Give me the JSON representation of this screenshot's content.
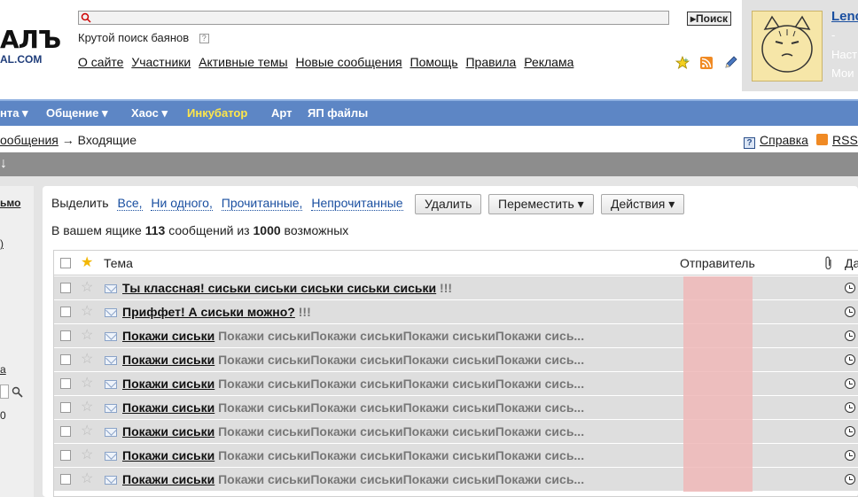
{
  "logo": {
    "main": "АЛЪ",
    "sub": "AL.COM"
  },
  "search": {
    "value": "",
    "button": "Поиск"
  },
  "tagline": {
    "text": "Крутой поиск баянов",
    "help": "?"
  },
  "topnav": [
    "О сайте",
    "Участники",
    "Активные темы",
    "Новые сообщения",
    "Помощь",
    "Правила",
    "Реклама"
  ],
  "profile": {
    "username": "Lenc",
    "dash": "-",
    "link1": "Наст",
    "link2": "Мои"
  },
  "menu": [
    {
      "label": "нта ▾"
    },
    {
      "label": "Общение ▾"
    },
    {
      "label": "Хаос ▾"
    },
    {
      "label": "Инкубатор"
    },
    {
      "label": "Арт"
    },
    {
      "label": "ЯП файлы"
    }
  ],
  "breadcrumb": {
    "link": "ообщения",
    "arrow": "→",
    "current": "Входящие"
  },
  "help_link": "Справка",
  "rss_link": "RSS",
  "grayband_arrow": "↓",
  "leftpanel": {
    "t1": "ьмо",
    "t2": ")",
    "t3": "а",
    "t4": "0"
  },
  "select": {
    "label": "Выделить",
    "all": "Все,",
    "none": "Ни одного,",
    "read": "Прочитанные,",
    "unread": "Непрочитанные"
  },
  "buttons": {
    "delete": "Удалить",
    "move": "Переместить ▾",
    "actions": "Действия ▾"
  },
  "count": {
    "prefix": "В вашем ящике",
    "n": "113",
    "mid": "сообщений из",
    "max": "1000",
    "suffix": "возможных"
  },
  "table": {
    "col_subject": "Тема",
    "col_sender": "Отправитель",
    "col_date": "Да",
    "rows": [
      {
        "title": "Ты классная! сиськи сиськи сиськи сиськи сиськи",
        "preview": " !!!"
      },
      {
        "title": "Приффет! А сиськи можно?",
        "preview": " !!!"
      },
      {
        "title": "Покажи сиськи",
        "preview": " Покажи сиськиПокажи сиськиПокажи сиськиПокажи сись..."
      },
      {
        "title": "Покажи сиськи",
        "preview": " Покажи сиськиПокажи сиськиПокажи сиськиПокажи сись..."
      },
      {
        "title": "Покажи сиськи",
        "preview": " Покажи сиськиПокажи сиськиПокажи сиськиПокажи сись..."
      },
      {
        "title": "Покажи сиськи",
        "preview": " Покажи сиськиПокажи сиськиПокажи сиськиПокажи сись..."
      },
      {
        "title": "Покажи сиськи",
        "preview": " Покажи сиськиПокажи сиськиПокажи сиськиПокажи сись..."
      },
      {
        "title": "Покажи сиськи",
        "preview": " Покажи сиськиПокажи сиськиПокажи сиськиПокажи сись..."
      },
      {
        "title": "Покажи сиськи",
        "preview": " Покажи сиськиПокажи сиськиПокажи сиськиПокажи сись..."
      }
    ]
  },
  "colors": {
    "menubar": "#5d86c5",
    "menu_highlight": "#ffe74a",
    "grayband": "#8d8d8d",
    "row": "#dedede",
    "sender_blur": "#f0b8b8"
  },
  "icons": [
    "search-icon",
    "star-add-icon",
    "rss-icon",
    "edit-pencil-icon",
    "help-icon",
    "star-icon",
    "envelope-icon",
    "paperclip-icon",
    "clock-icon"
  ]
}
